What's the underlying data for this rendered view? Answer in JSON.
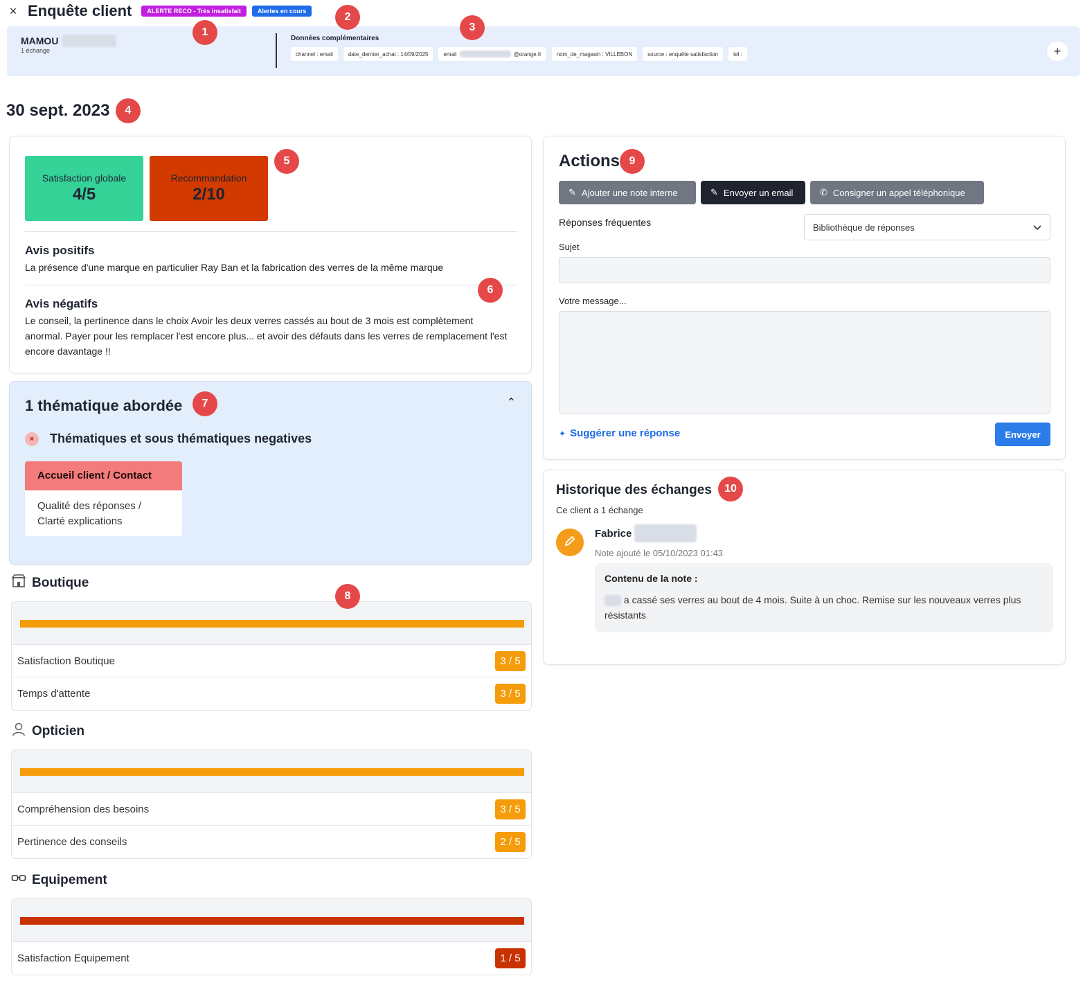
{
  "header": {
    "close_icon": "×",
    "title": "Enquête client",
    "badges": [
      {
        "label": "ALERTE RECO - Très insatisfait",
        "color": "#c21ee0"
      },
      {
        "label": "Alertes en cours",
        "color": "#1e6ce8"
      }
    ]
  },
  "client": {
    "name": "MAMOU",
    "exchanges": "1 échange",
    "extra_title": "Données complémentaires",
    "chips": [
      "channel : email",
      "date_dernier_achat : 14/09/2025",
      "email",
      "@orange.fr",
      "nom_de_magasin : VILLEBON",
      "source : enquête satisfaction",
      "tel :"
    ],
    "add_icon": "+"
  },
  "date": "30 sept. 2023",
  "markers": [
    "1",
    "2",
    "3",
    "4",
    "5",
    "6",
    "7",
    "8",
    "9",
    "10"
  ],
  "scores": {
    "satisfaction_label": "Satisfaction globale",
    "satisfaction_value": "4/5",
    "satisfaction_color": "#36d399",
    "reco_label": "Recommandation",
    "reco_value": "2/10",
    "reco_color": "#d23a00"
  },
  "opinions": {
    "positive_title": "Avis positifs",
    "positive_text": "La présence d'une marque en particulier Ray Ban et la fabrication des verres de la même marque",
    "negative_title": "Avis négatifs",
    "negative_text": "Le conseil, la pertinence dans le choix Avoir les deux verres cassés au bout de 3 mois est complètement anormal. Payer pour les remplacer l'est encore plus... et avoir des défauts dans les verres de remplacement l'est encore davantage !!"
  },
  "themes": {
    "title": "1 thématique abordée",
    "collapse_icon": "⌃",
    "negative_label": "Thématiques et sous thématiques negatives",
    "negative_icon": "×",
    "theme": "Accueil client / Contact",
    "subtheme": "Qualité des réponses / Clarté explications"
  },
  "rating_sections": [
    {
      "title": "Boutique",
      "icon": "store-icon",
      "bar_color": "#f59c0a",
      "rows": [
        {
          "label": "Satisfaction Boutique",
          "score": "3 / 5",
          "color": "#f59c0a"
        },
        {
          "label": "Temps d'attente",
          "score": "3 / 5",
          "color": "#f59c0a"
        }
      ]
    },
    {
      "title": "Opticien",
      "icon": "optician-icon",
      "bar_color": "#f59c0a",
      "rows": [
        {
          "label": "Compréhension des besoins",
          "score": "3 / 5",
          "color": "#f59c0a"
        },
        {
          "label": "Pertinence des conseils",
          "score": "2 / 5",
          "color": "#f59c0a"
        }
      ]
    },
    {
      "title": "Equipement",
      "icon": "glasses-icon",
      "bar_color": "#c93200",
      "rows": [
        {
          "label": "Satisfaction Equipement",
          "score": "1 / 5",
          "color": "#c93200"
        }
      ]
    }
  ],
  "actions": {
    "title": "Actions",
    "buttons": [
      {
        "label": "Ajouter une note interne",
        "icon": "✎"
      },
      {
        "label": "Envoyer un email",
        "icon": "✎"
      },
      {
        "label": "Consigner un appel téléphonique",
        "icon": "✆"
      }
    ],
    "frequent_label": "Réponses fréquentes",
    "library_placeholder": "Bibliothèque de réponses",
    "subject_label": "Sujet",
    "message_label": "Votre message...",
    "suggest_label": "Suggérer une réponse",
    "send_label": "Envoyer"
  },
  "history": {
    "title": "Historique des échanges",
    "subtitle": "Ce client a 1 échange",
    "author": "Fabrice",
    "date": "Note ajouté le 05/10/2023 01:43",
    "note_title": "Contenu de la note :",
    "note_text": "a cassé ses verres au bout de 4 mois. Suite à un choc. Remise sur les nouveaux verres plus résistants"
  }
}
